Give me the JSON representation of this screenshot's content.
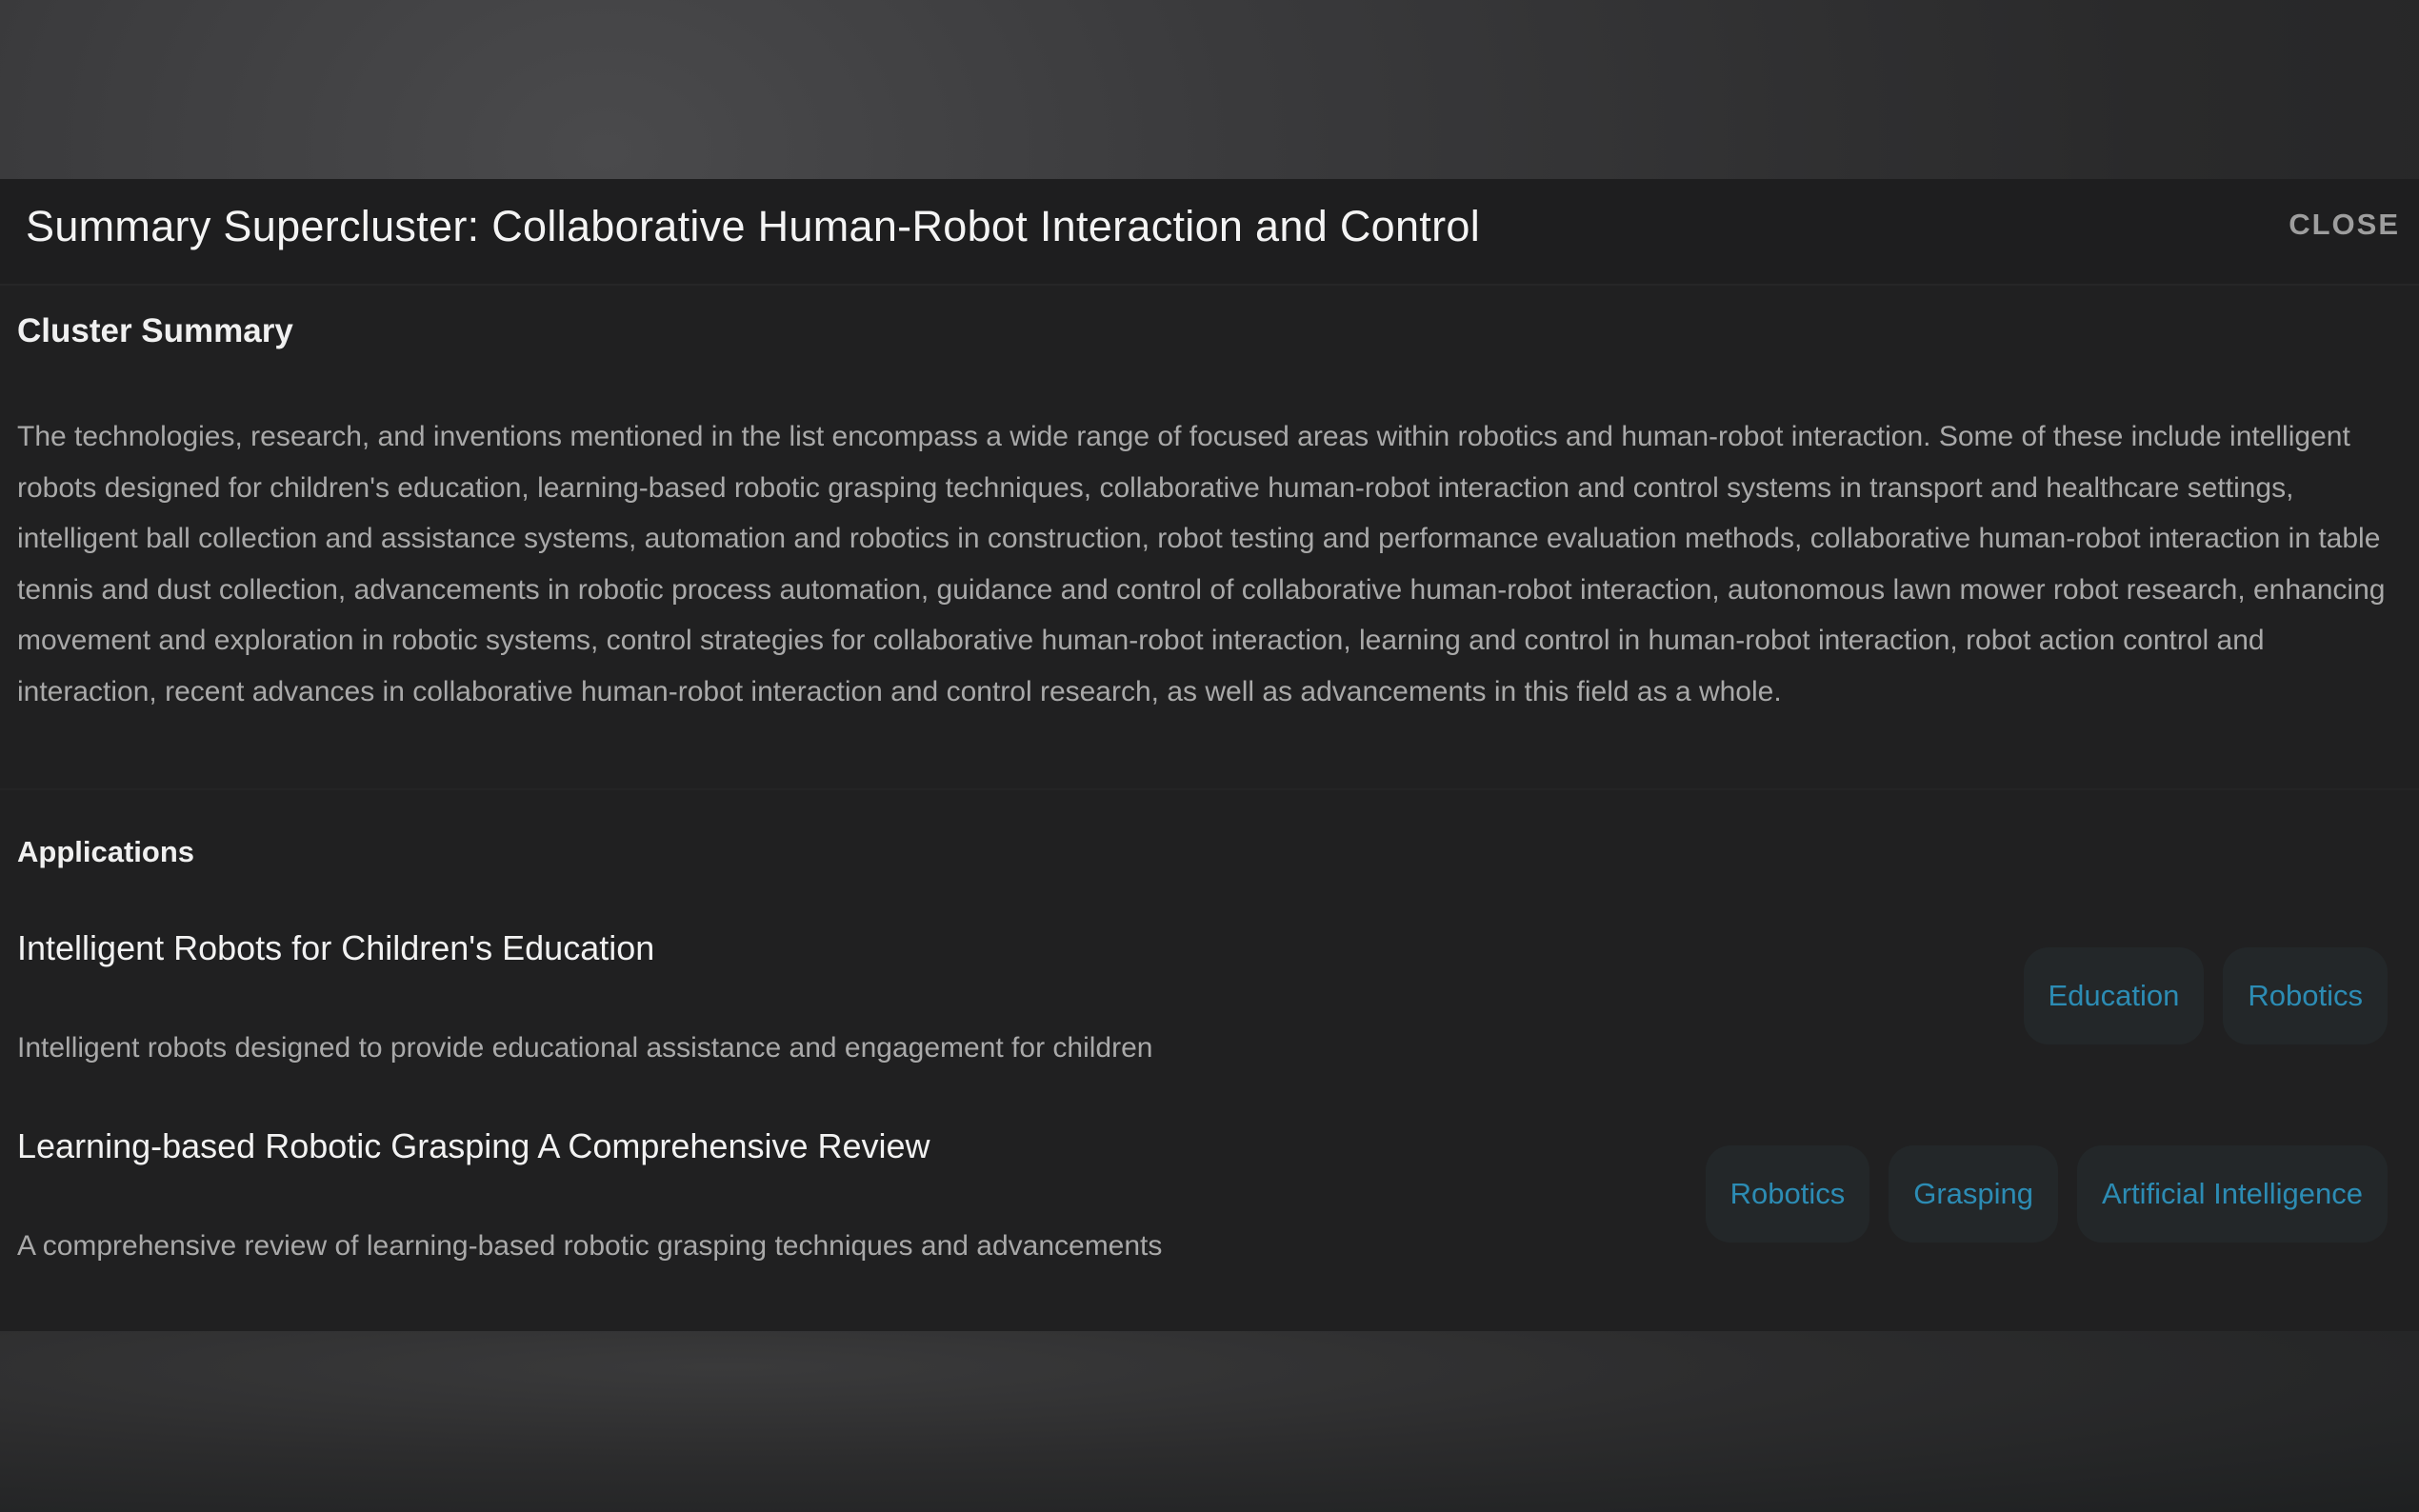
{
  "dialog": {
    "title": "Summary Supercluster: Collaborative Human-Robot Interaction and Control",
    "close_label": "CLOSE"
  },
  "summary": {
    "heading": "Cluster Summary",
    "text": "The technologies, research, and inventions mentioned in the list encompass a wide range of focused areas within robotics and human-robot interaction. Some of these include intelligent robots designed for children's education, learning-based robotic grasping techniques, collaborative human-robot interaction and control systems in transport and healthcare settings, intelligent ball collection and assistance systems, automation and robotics in construction, robot testing and performance evaluation methods, collaborative human-robot interaction in table tennis and dust collection, advancements in robotic process automation, guidance and control of collaborative human-robot interaction, autonomous lawn mower robot research, enhancing movement and exploration in robotic systems, control strategies for collaborative human-robot interaction, learning and control in human-robot interaction, robot action control and interaction, recent advances in collaborative human-robot interaction and control research, as well as advancements in this field as a whole."
  },
  "applications": {
    "heading": "Applications",
    "items": [
      {
        "name": "Intelligent Robots for Children's Education",
        "description": "Intelligent robots designed to provide educational assistance and engagement for children",
        "tags": [
          "Education",
          "Robotics"
        ]
      },
      {
        "name": "Learning-based Robotic Grasping A Comprehensive Review",
        "description": "A comprehensive review of learning-based robotic grasping techniques and advancements",
        "tags": [
          "Robotics",
          "Grasping",
          "Artificial Intelligence"
        ]
      }
    ]
  },
  "colors": {
    "backdrop": "#3a3a3c",
    "dialog_bg": "#202021",
    "tag_bg": "#232729",
    "tag_text": "#2c8cb4",
    "body_text": "#a9a9a9"
  }
}
